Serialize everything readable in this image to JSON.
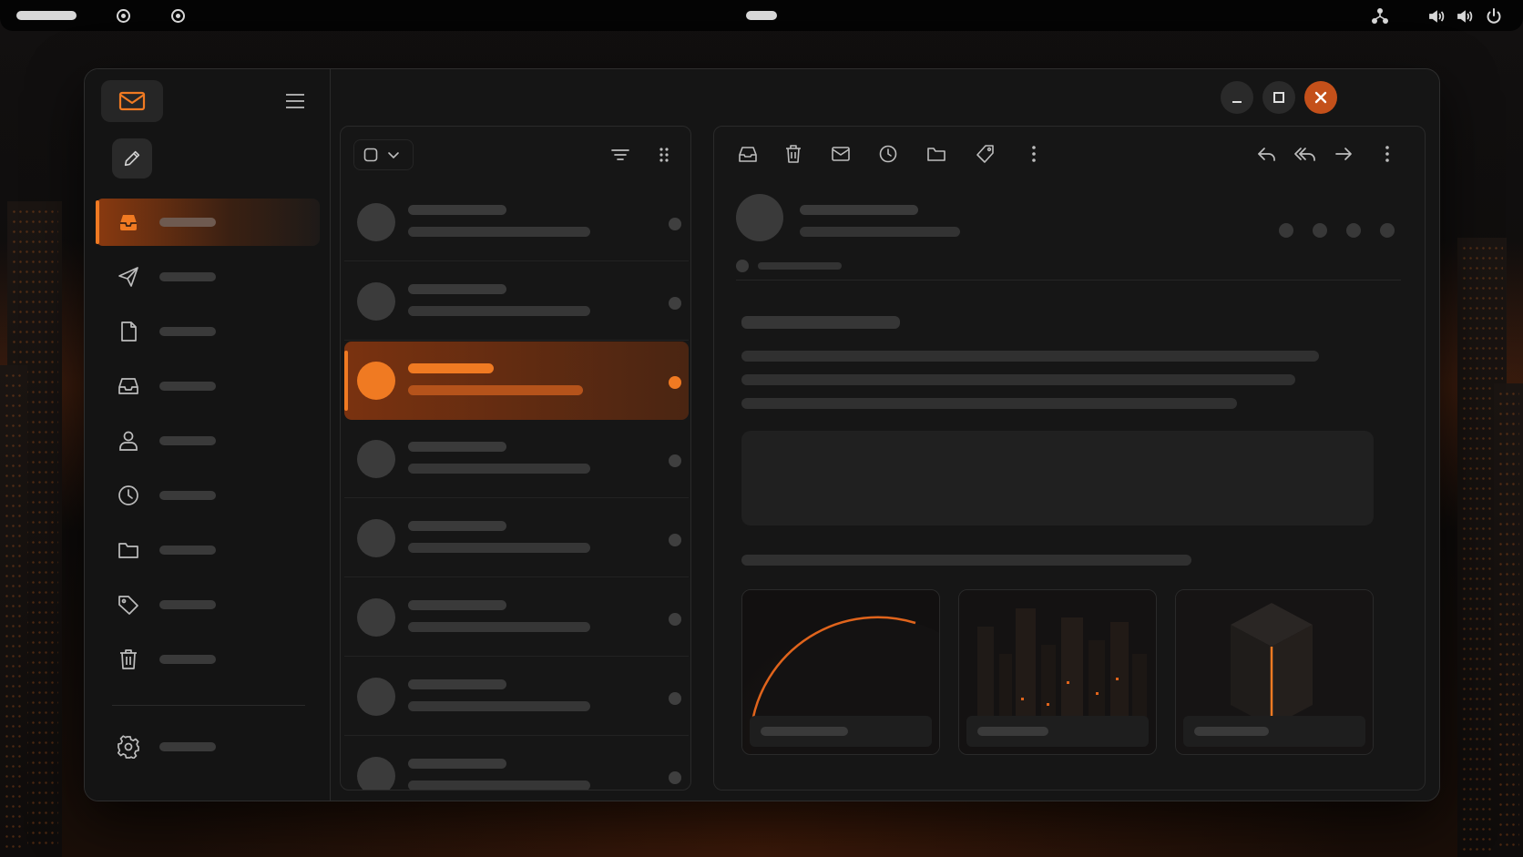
{
  "colors": {
    "accent": "#f07a22",
    "accent_dark": "#7a3210",
    "window_bg": "#151515",
    "panel_bg": "#161616",
    "placeholder": "#3a3a3a",
    "close_button": "#c4501a"
  },
  "system_bar": {
    "left_indicators": [
      "pill-indicator",
      "record-indicator",
      "record-indicator"
    ],
    "center_indicator": "pill-indicator",
    "tray_icons": [
      "network-icon",
      "volume-icon",
      "volume-icon",
      "power-icon"
    ]
  },
  "window": {
    "controls": [
      "minimize-icon",
      "maximize-icon",
      "close-icon"
    ]
  },
  "sidebar": {
    "logo_icon": "mail-icon",
    "menu_icon": "hamburger-menu-icon",
    "compose_icon": "pencil-icon",
    "items": [
      {
        "icon": "inbox-icon",
        "label": "",
        "active": true
      },
      {
        "icon": "send-icon",
        "label": "",
        "active": false
      },
      {
        "icon": "document-icon",
        "label": "",
        "active": false
      },
      {
        "icon": "tray-icon",
        "label": "",
        "active": false
      },
      {
        "icon": "person-icon",
        "label": "",
        "active": false
      },
      {
        "icon": "clock-icon",
        "label": "",
        "active": false
      },
      {
        "icon": "folder-icon",
        "label": "",
        "active": false
      },
      {
        "icon": "tag-icon",
        "label": "",
        "active": false
      },
      {
        "icon": "trash-icon",
        "label": "",
        "active": false
      }
    ],
    "settings": {
      "icon": "gear-icon",
      "label": ""
    }
  },
  "message_list": {
    "toolbar_icons": [
      "checkbox-icon",
      "chevron-down-icon",
      "filter-icon",
      "drag-handle-icon"
    ],
    "selected_index": 2,
    "messages": [
      {
        "sender": "",
        "subject": "",
        "unread": false
      },
      {
        "sender": "",
        "subject": "",
        "unread": false
      },
      {
        "sender": "",
        "subject": "",
        "unread": true
      },
      {
        "sender": "",
        "subject": "",
        "unread": false
      },
      {
        "sender": "",
        "subject": "",
        "unread": false
      },
      {
        "sender": "",
        "subject": "",
        "unread": false
      },
      {
        "sender": "",
        "subject": "",
        "unread": false
      },
      {
        "sender": "",
        "subject": "",
        "unread": false
      }
    ]
  },
  "reader": {
    "toolbar_left": [
      "archive-icon",
      "trash-icon",
      "mail-icon",
      "clock-icon",
      "folder-icon",
      "tag-icon",
      "more-vertical-icon"
    ],
    "toolbar_right": [
      "reply-icon",
      "reply-all-icon",
      "forward-icon",
      "more-vertical-icon"
    ],
    "sender_name": "",
    "sender_address": "",
    "recipient": "",
    "subject": "",
    "body_lines": [
      "",
      "",
      ""
    ],
    "quote": "",
    "footer_line": "",
    "attachments": [
      {
        "name": "",
        "preview": "planet-arc"
      },
      {
        "name": "",
        "preview": "city-skyline"
      },
      {
        "name": "",
        "preview": "glowing-cube"
      }
    ]
  }
}
